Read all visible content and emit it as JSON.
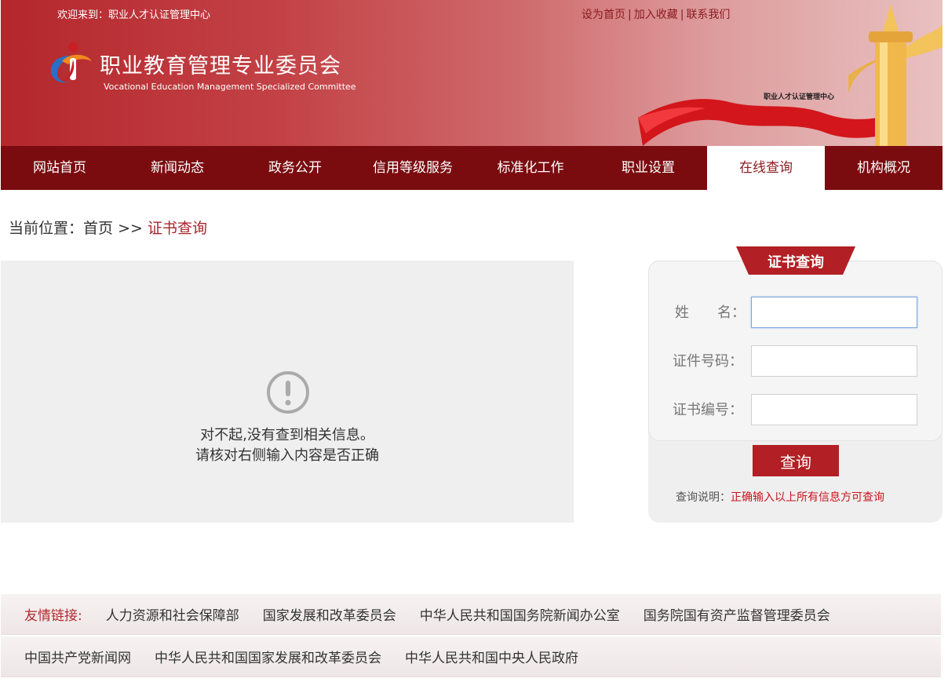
{
  "header": {
    "welcome": "欢迎来到：职业人才认证管理中心",
    "toplinks": [
      "设为首页",
      "加入收藏",
      "联系我们"
    ],
    "separator": "|",
    "title": "职业教育管理专业委员会",
    "subtitle": "Vocational Education Management  Specialized Committee",
    "caption": "职业人才认证管理中心"
  },
  "nav": {
    "items": [
      "网站首页",
      "新闻动态",
      "政务公开",
      "信用等级服务",
      "标准化工作",
      "职业设置",
      "在线查询",
      "机构概况"
    ],
    "active": "在线查询"
  },
  "breadcrumb": {
    "prefix": "当前位置：",
    "home": "首页",
    "sep": " >> ",
    "current": "证书查询"
  },
  "result": {
    "line1": "对不起,没有查到相关信息。",
    "line2": "请核对右侧输入内容是否正确"
  },
  "query": {
    "tab": "证书查询",
    "name_label": "姓　　名：",
    "id_label": "证件号码：",
    "cert_label": "证书编号：",
    "name_value": "",
    "id_value": "",
    "cert_value": "",
    "submit": "查询",
    "note_prefix": "查询说明：",
    "note_text": "正确输入以上所有信息方可查询"
  },
  "links": {
    "title": "友情链接:",
    "row1": [
      "人力资源和社会保障部",
      "国家发展和改革委员会",
      "中华人民共和国国务院新闻办公室",
      "国务院国有资产监督管理委员会"
    ],
    "row2": [
      "中国共产党新闻网",
      "中华人民共和国国家发展和改革委员会",
      "中华人民共和国中央人民政府"
    ]
  },
  "colors": {
    "brand_red": "#b4272c",
    "nav_dark": "#7a0c10",
    "note_red": "#c8161d"
  }
}
